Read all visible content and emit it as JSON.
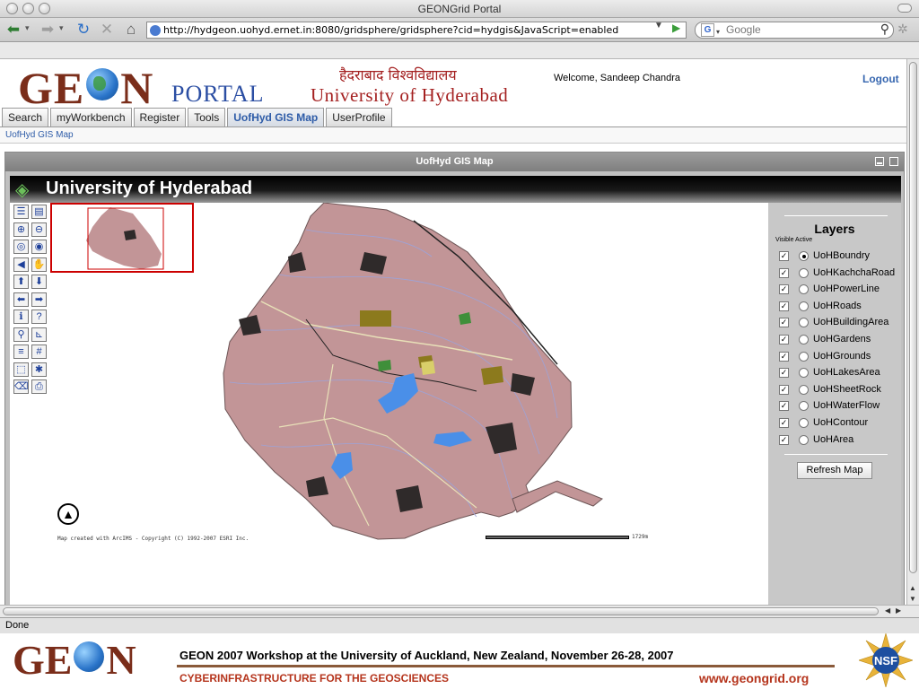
{
  "browser": {
    "window_title": "GEONGrid Portal",
    "url": "http://hydgeon.uohyd.ernet.in:8080/gridsphere/gridsphere?cid=hydgis&JavaScript=enabled",
    "search_placeholder": "Google",
    "search_engine_letter": "G",
    "status": "Done"
  },
  "header": {
    "logo_left": "GE",
    "logo_right": "N",
    "portal_word": "PORTAL",
    "university_hindi": "हैदराबाद विश्वविद्यालय",
    "university_english": "University of Hyderabad",
    "welcome": "Welcome, Sandeep Chandra",
    "logout": "Logout"
  },
  "tabs": [
    {
      "label": "Search",
      "active": false
    },
    {
      "label": "myWorkbench",
      "active": false
    },
    {
      "label": "Register",
      "active": false
    },
    {
      "label": "Tools",
      "active": false
    },
    {
      "label": "UofHyd GIS Map",
      "active": true
    },
    {
      "label": "UserProfile",
      "active": false
    }
  ],
  "breadcrumb": "UofHyd GIS Map",
  "portlet": {
    "title": "UofHyd GIS Map",
    "banner_title": "University of Hyderabad"
  },
  "map": {
    "credit": "Map created with ArcIMS - Copyright (C) 1992-2007 ESRI Inc.",
    "scale_label": "1729m",
    "colors": {
      "land": "#c29597",
      "buildings": "#8c7a1d",
      "water": "#4a8fe8",
      "dark_features": "#2f2a2a",
      "contours": "#9da3d8",
      "roads": "#e8e0b8"
    }
  },
  "layers_panel": {
    "title": "Layers",
    "subheader": "Visible Active",
    "layers": [
      {
        "name": "UoHBoundry",
        "visible": true,
        "active": true
      },
      {
        "name": "UoHKachchaRoad",
        "visible": true,
        "active": false
      },
      {
        "name": "UoHPowerLine",
        "visible": true,
        "active": false
      },
      {
        "name": "UoHRoads",
        "visible": true,
        "active": false
      },
      {
        "name": "UoHBuildingArea",
        "visible": true,
        "active": false
      },
      {
        "name": "UoHGardens",
        "visible": true,
        "active": false
      },
      {
        "name": "UoHGrounds",
        "visible": true,
        "active": false
      },
      {
        "name": "UoHLakesArea",
        "visible": true,
        "active": false
      },
      {
        "name": "UoHSheetRock",
        "visible": true,
        "active": false
      },
      {
        "name": "UoHWaterFlow",
        "visible": true,
        "active": false
      },
      {
        "name": "UoHContour",
        "visible": true,
        "active": false
      },
      {
        "name": "UoHArea",
        "visible": true,
        "active": false
      }
    ],
    "refresh_label": "Refresh Map"
  },
  "tools": [
    {
      "name": "toggle-toc-tool",
      "glyph": "☰"
    },
    {
      "name": "legend-tool",
      "glyph": "▤"
    },
    {
      "name": "zoom-in-tool",
      "glyph": "⊕"
    },
    {
      "name": "zoom-out-tool",
      "glyph": "⊖"
    },
    {
      "name": "full-extent-tool",
      "glyph": "◎"
    },
    {
      "name": "zoom-active-tool",
      "glyph": "◉"
    },
    {
      "name": "back-extent-tool",
      "glyph": "◀"
    },
    {
      "name": "pan-tool",
      "glyph": "✋"
    },
    {
      "name": "pan-north-tool",
      "glyph": "⬆"
    },
    {
      "name": "pan-south-tool",
      "glyph": "⬇"
    },
    {
      "name": "pan-west-tool",
      "glyph": "⬅"
    },
    {
      "name": "pan-east-tool",
      "glyph": "➡"
    },
    {
      "name": "identify-tool",
      "glyph": "ℹ"
    },
    {
      "name": "query-tool",
      "glyph": "?"
    },
    {
      "name": "find-tool",
      "glyph": "⚲"
    },
    {
      "name": "measure-tool",
      "glyph": "⊾"
    },
    {
      "name": "set-units-tool",
      "glyph": "≡"
    },
    {
      "name": "buffer-tool",
      "glyph": "#"
    },
    {
      "name": "select-rect-tool",
      "glyph": "⬚"
    },
    {
      "name": "select-point-tool",
      "glyph": "✱"
    },
    {
      "name": "clear-selection-tool",
      "glyph": "⌫"
    },
    {
      "name": "print-tool",
      "glyph": "⎙"
    }
  ],
  "footer": {
    "logo_left": "GE",
    "logo_right": "N",
    "headline": "GEON 2007 Workshop at the University of Auckland, New Zealand, November 26-28, 2007",
    "tagline": "CYBERINFRASTRUCTURE FOR THE GEOSCIENCES",
    "url": "www.geongrid.org",
    "nsf": "NSF"
  }
}
